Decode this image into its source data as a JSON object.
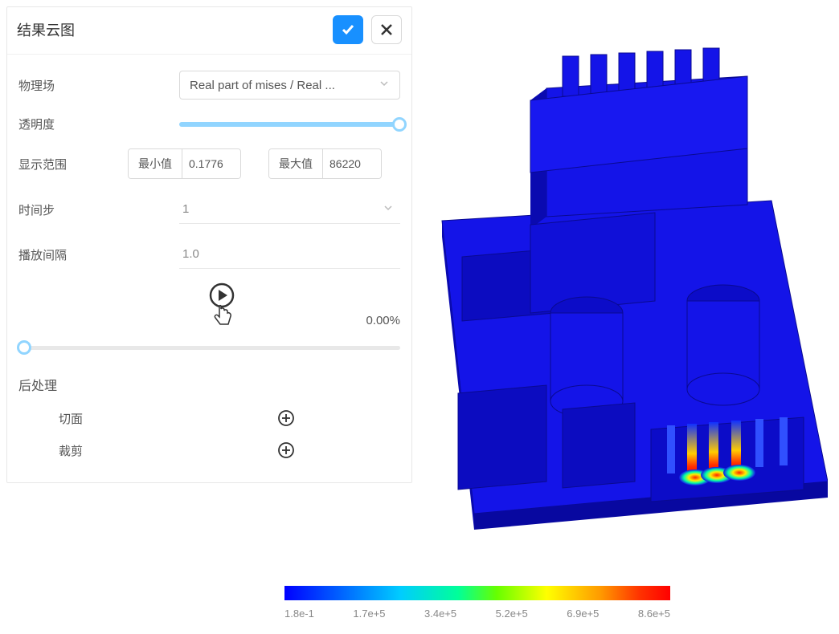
{
  "panel": {
    "title": "结果云图",
    "fields": {
      "physics_label": "物理场",
      "physics_value": "Real part of mises / Real ...",
      "opacity_label": "透明度",
      "range_label": "显示范围",
      "min_label": "最小值",
      "min_value": "0.1776",
      "max_label": "最大值",
      "max_value": "86220",
      "timestep_label": "时间步",
      "timestep_value": "1",
      "interval_label": "播放间隔",
      "interval_value": "1.0",
      "progress_text": "0.00%",
      "postprocess_title": "后处理",
      "slice_label": "切面",
      "clip_label": "裁剪"
    }
  },
  "legend": {
    "ticks": [
      "1.8e-1",
      "1.7e+5",
      "3.4e+5",
      "5.2e+5",
      "6.9e+5",
      "8.6e+5"
    ]
  }
}
